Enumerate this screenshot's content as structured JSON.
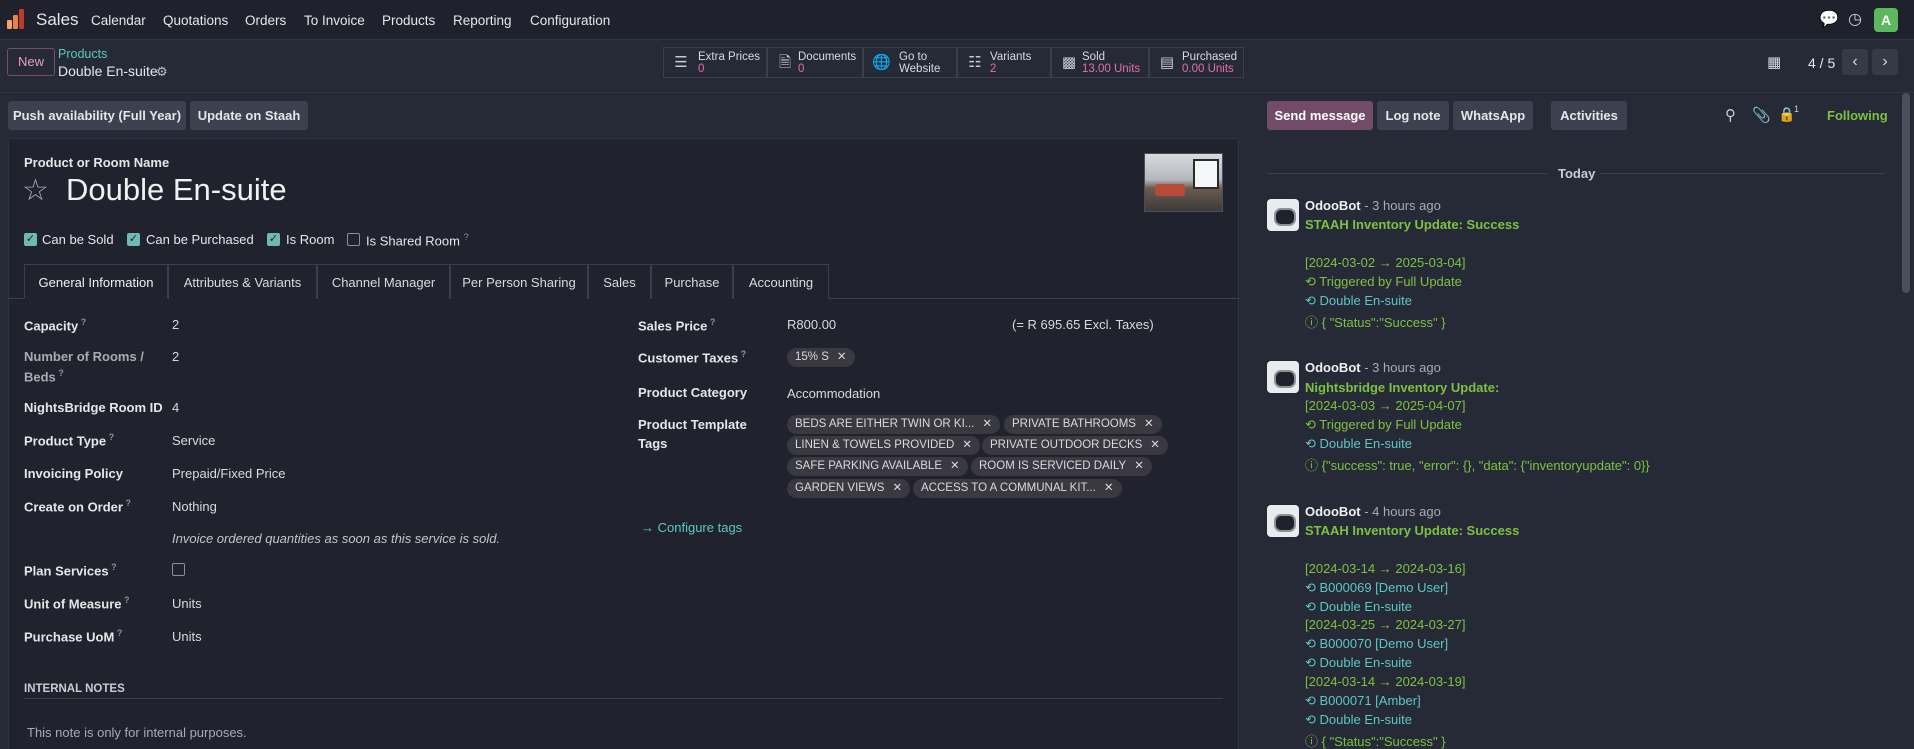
{
  "app": {
    "name": "Sales"
  },
  "menu": [
    "Calendar",
    "Quotations",
    "Orders",
    "To Invoice",
    "Products",
    "Reporting",
    "Configuration"
  ],
  "user": {
    "avatar_letter": "A"
  },
  "control_panel": {
    "new_label": "New",
    "breadcrumb_parent": "Products",
    "breadcrumb_current": "Double En-suite",
    "pager": "4 / 5"
  },
  "stat_buttons": [
    {
      "label": "Extra Prices",
      "value": "0"
    },
    {
      "label": "Documents",
      "value": "0"
    },
    {
      "label": "Go to",
      "value": "Website"
    },
    {
      "label": "Variants",
      "value": "2"
    },
    {
      "label": "Sold",
      "value": "13.00 Units"
    },
    {
      "label": "Purchased",
      "value": "0.00 Units"
    }
  ],
  "actions": {
    "push_availability": "Push availability (Full Year)",
    "update_staah": "Update on Staah"
  },
  "form": {
    "name_label": "Product or Room Name",
    "name": "Double En-suite",
    "checkboxes": [
      {
        "label": "Can be Sold",
        "checked": true
      },
      {
        "label": "Can be Purchased",
        "checked": true
      },
      {
        "label": "Is Room",
        "checked": true
      },
      {
        "label": "Is Shared Room",
        "checked": false
      }
    ],
    "tabs": [
      "General Information",
      "Attributes & Variants",
      "Channel Manager",
      "Per Person Sharing",
      "Sales",
      "Purchase",
      "Accounting"
    ],
    "left_fields": {
      "capacity_label": "Capacity",
      "capacity": "2",
      "rooms_label_1": "Number of Rooms /",
      "rooms_label_2": "Beds",
      "rooms": "2",
      "nb_id_label": "NightsBridge Room ID",
      "nb_id": "4",
      "type_label": "Product Type",
      "type": "Service",
      "invoicing_label": "Invoicing Policy",
      "invoicing": "Prepaid/Fixed Price",
      "create_label": "Create on Order",
      "create": "Nothing",
      "invoice_hint": "Invoice ordered quantities as soon as this service is sold.",
      "plan_label": "Plan Services",
      "uom_label": "Unit of Measure",
      "uom": "Units",
      "puom_label": "Purchase UoM",
      "puom": "Units"
    },
    "right_fields": {
      "price_label": "Sales Price",
      "price": "R800.00",
      "price_excl": "(= R 695.65 Excl. Taxes)",
      "taxes_label": "Customer Taxes",
      "tax_tag": "15% S",
      "category_label": "Product Category",
      "category": "Accommodation",
      "tags_label_1": "Product Template",
      "tags_label_2": "Tags",
      "tags": [
        "BEDS ARE EITHER TWIN OR KI...",
        "PRIVATE BATHROOMS",
        "LINEN & TOWELS PROVIDED",
        "PRIVATE OUTDOOR DECKS",
        "SAFE PARKING AVAILABLE",
        "ROOM IS SERVICED DAILY",
        "GARDEN VIEWS",
        "ACCESS TO A COMMUNAL KIT..."
      ],
      "configure_tags": "Configure tags"
    },
    "internal_notes_title": "INTERNAL NOTES",
    "internal_notes_placeholder": "This note is only for internal purposes."
  },
  "chatter": {
    "send_message": "Send message",
    "log_note": "Log note",
    "whatsapp": "WhatsApp",
    "activities": "Activities",
    "attachments_count": "1",
    "following": "Following",
    "today": "Today",
    "messages": [
      {
        "author": "OdooBot",
        "time": "- 3 hours ago",
        "title": "STAAH Inventory Update: Success",
        "lines": [
          "[2024-03-02 → 2025-03-04]",
          "⟲ Triggered by Full Update",
          "⟲ Double En-suite",
          "ⓘ { \"Status\":\"Success\" }"
        ]
      },
      {
        "author": "OdooBot",
        "time": "- 3 hours ago",
        "title": "Nightsbridge Inventory Update:",
        "lines": [
          "[2024-03-03 → 2025-04-07]",
          "⟲ Triggered by Full Update",
          "⟲ Double En-suite",
          "ⓘ {\"success\": true, \"error\": {}, \"data\": {\"inventoryupdate\": 0}}"
        ]
      },
      {
        "author": "OdooBot",
        "time": "- 4 hours ago",
        "title": "STAAH Inventory Update: Success",
        "lines": [
          "[2024-03-14 → 2024-03-16]",
          "⟲ B000069 [Demo User]",
          "⟲ Double En-suite",
          "[2024-03-25 → 2024-03-27]",
          "⟲ B000070 [Demo User]",
          "⟲ Double En-suite",
          "[2024-03-14 → 2024-03-19]",
          "⟲ B000071 [Amber]",
          "⟲ Double En-suite",
          "ⓘ { \"Status\":\"Success\" }"
        ]
      }
    ]
  }
}
